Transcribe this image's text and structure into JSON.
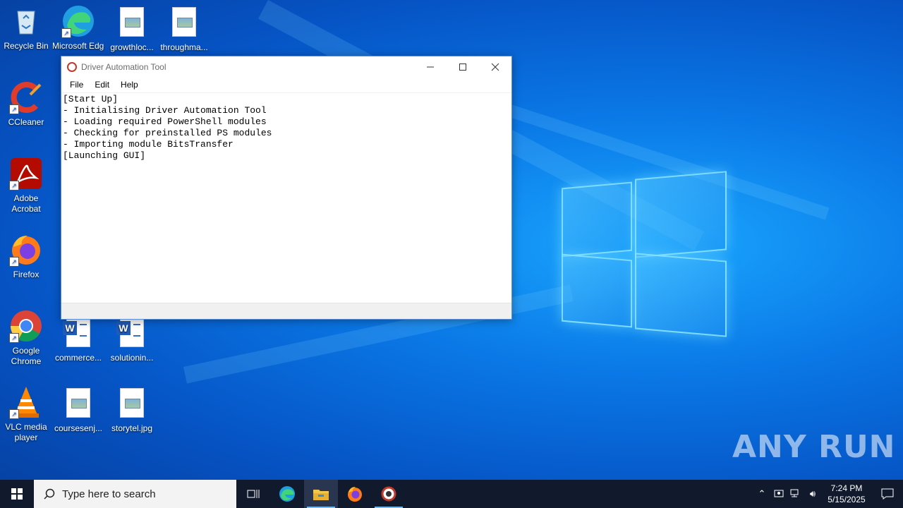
{
  "desktop": {
    "icons": [
      {
        "label": "Recycle Bin"
      },
      {
        "label": "Microsoft Edge"
      },
      {
        "label": "growthloc..."
      },
      {
        "label": "throughma..."
      },
      {
        "label": "CCleaner"
      },
      {
        "label": "Adobe Acrobat"
      },
      {
        "label": "Firefox"
      },
      {
        "label": "Google Chrome"
      },
      {
        "label": "commerce..."
      },
      {
        "label": "solutionin..."
      },
      {
        "label": "VLC media player"
      },
      {
        "label": "coursesenj..."
      },
      {
        "label": "storytel.jpg"
      }
    ],
    "watermark": "ANY RUN"
  },
  "window": {
    "title": "Driver Automation Tool",
    "menu": [
      "File",
      "Edit",
      "Help"
    ],
    "log": "[Start Up]\n- Initialising Driver Automation Tool\n- Loading required PowerShell modules\n- Checking for preinstalled PS modules\n- Importing module BitsTransfer\n[Launching GUI]"
  },
  "taskbar": {
    "search_placeholder": "Type here to search",
    "time": "7:24 PM",
    "date": "5/15/2025"
  }
}
